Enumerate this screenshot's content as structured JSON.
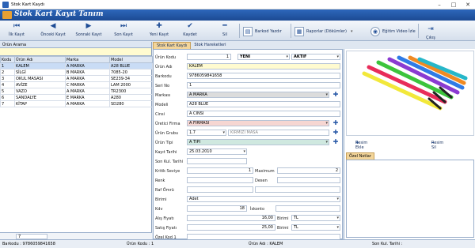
{
  "window": {
    "title": "Stok Kart Kaydı",
    "minimize": "–",
    "maximize": "□",
    "close": "✕"
  },
  "banner": {
    "title": "Stok Kart Kayıt Tanım"
  },
  "toolbar": {
    "first": "İlk Kayıt",
    "prev": "Önceki Kayıt",
    "next": "Sonraki Kayıt",
    "last": "Son Kayıt",
    "new": "Yeni Kayıt",
    "save": "Kaydet",
    "delete": "Sil",
    "barcode": "Barkod Yazdır",
    "reports": "Raporlar (Dökümler)",
    "video": "Eğitim Video İzle",
    "exit": "Çıkış"
  },
  "list": {
    "search_label": "Ürün Arama",
    "columns": [
      "Kodu",
      "Ürün Adı",
      "Marka",
      "Model"
    ],
    "rows": [
      [
        "1",
        "KALEM",
        "A MARKA",
        "A28 BLUE"
      ],
      [
        "2",
        "SİLGİ",
        "B MARKA",
        "7085-20"
      ],
      [
        "3",
        "OKUL MASASI",
        "A MARKA",
        "SE239-34"
      ],
      [
        "4",
        "AVİZE",
        "C MARKA",
        "LAM 2000"
      ],
      [
        "5",
        "VAZO",
        "A MARKA",
        "TR2300"
      ],
      [
        "6",
        "SANDALYE",
        "E MARKA",
        "A280"
      ],
      [
        "7",
        "KİTAP",
        "A MARKA",
        "SD280"
      ]
    ],
    "count": "7"
  },
  "tabs": {
    "card": "Stok Kart Kaydı",
    "movements": "Stok Hareketleri"
  },
  "form": {
    "product_code_label": "Ürün Kodu",
    "product_code": "1",
    "state": "YENİ",
    "status": "AKTİF",
    "product_name_label": "Ürün Adı",
    "product_name": "KALEM",
    "barcode_label": "Barkodu",
    "barcode": "9786059841658",
    "serial_label": "Seri No",
    "serial": "1",
    "brand_label": "Markası",
    "brand": "A MARKA",
    "model_label": "Modeli",
    "model": "A28 BLUE",
    "type_label": "Cinsi",
    "type": "A CİNSİ",
    "maker_label": "Üretici Firma",
    "maker": "A FİRMASI",
    "group_label": "Ürün Grubu",
    "group": "1.7",
    "group_name": "KIRMIZI MASA",
    "kind_label": "Ürün Tipi",
    "kind": "A TİPİ",
    "reg_date_label": "Kayıt Tarihi",
    "reg_date": "25.03.2010",
    "last_use_label": "Son Kul. Tarihi",
    "critical_label": "Kritik Seviye",
    "critical": "1",
    "maximum_label": "Maximum",
    "maximum": "2",
    "color_label": "Renk",
    "size_label": "Desen",
    "shelf_label": "Raf Ömrü",
    "unit_label": "Birimi",
    "unit": "Adet",
    "vat_label": "Kdv",
    "vat": "18",
    "discount_label": "İskonto",
    "buy_label": "Alış Fiyatı",
    "buy": "16,00",
    "buy_unit_label": "Birimi",
    "buy_unit": "TL",
    "sell_label": "Satış Fiyatı",
    "sell": "25,00",
    "sell_unit_label": "Birimi",
    "sell_unit": "TL",
    "special_label": "Özel Kod 1"
  },
  "photo": {
    "add": "Resim Ekle",
    "remove": "Resim Sil"
  },
  "notes": {
    "tab": "Özel Notlar"
  },
  "status": {
    "barcode": "Barkodu : 9786059841658",
    "code": "Ürün Kodu : 1",
    "name": "Ürün Adı : KALEM",
    "last_sale": "Son Kul. Tarihi :"
  }
}
